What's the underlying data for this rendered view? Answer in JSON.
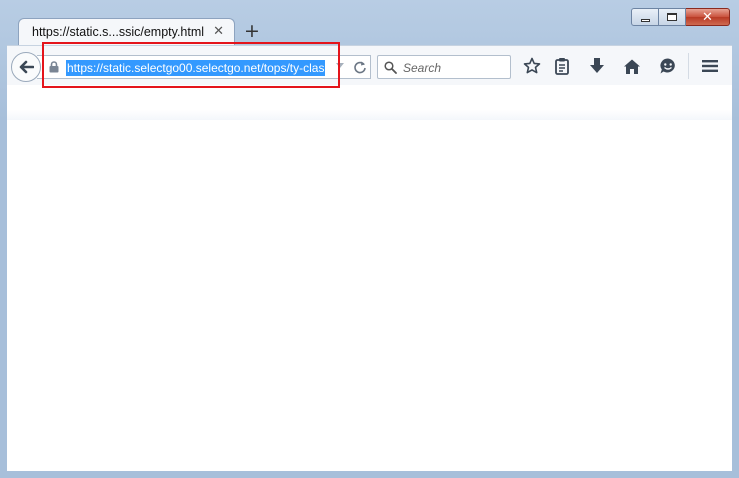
{
  "tab": {
    "title": "https://static.s...ssic/empty.html"
  },
  "urlbar": {
    "url": "https://static.selectgo00.selectgo.net/tops/ty-clas"
  },
  "search": {
    "placeholder": "Search"
  },
  "colors": {
    "selection": "#3399ff",
    "annotation": "#e4141b",
    "frame": "#a9c2dd"
  },
  "icons": {
    "back": "arrow-left-icon",
    "lock": "lock-icon",
    "reload": "reload-icon",
    "search": "search-icon",
    "bookmark": "star-icon",
    "reading-list": "clipboard-icon",
    "downloads": "download-arrow-icon",
    "home": "home-icon",
    "hello": "chat-face-icon",
    "menu": "hamburger-menu-icon"
  }
}
